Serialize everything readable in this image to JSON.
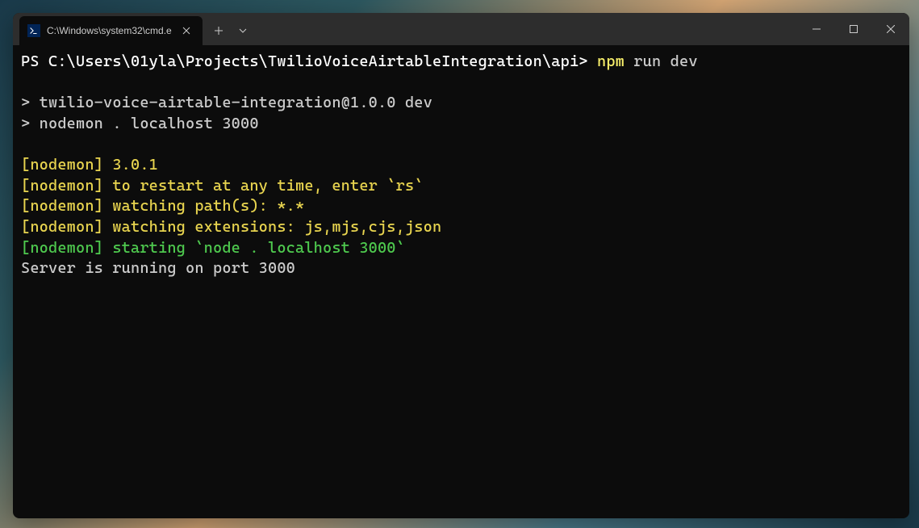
{
  "titlebar": {
    "tab_title": "C:\\Windows\\system32\\cmd.e",
    "tab_icon_label": "PS"
  },
  "terminal": {
    "prompt_prefix": "PS ",
    "prompt_path": "C:\\Users\\01yla\\Projects\\TwilioVoiceAirtableIntegration\\api>",
    "command_name": "npm",
    "command_args": " run dev",
    "script_line1": "> twilio-voice-airtable-integration@1.0.0 dev",
    "script_line2": "> nodemon . localhost 3000",
    "nodemon_version": "[nodemon] 3.0.1",
    "nodemon_restart": "[nodemon] to restart at any time, enter `rs`",
    "nodemon_watching_paths": "[nodemon] watching path(s): *.*",
    "nodemon_watching_ext": "[nodemon] watching extensions: js,mjs,cjs,json",
    "nodemon_starting": "[nodemon] starting `node . localhost 3000`",
    "server_running": "Server is running on port 3000"
  }
}
